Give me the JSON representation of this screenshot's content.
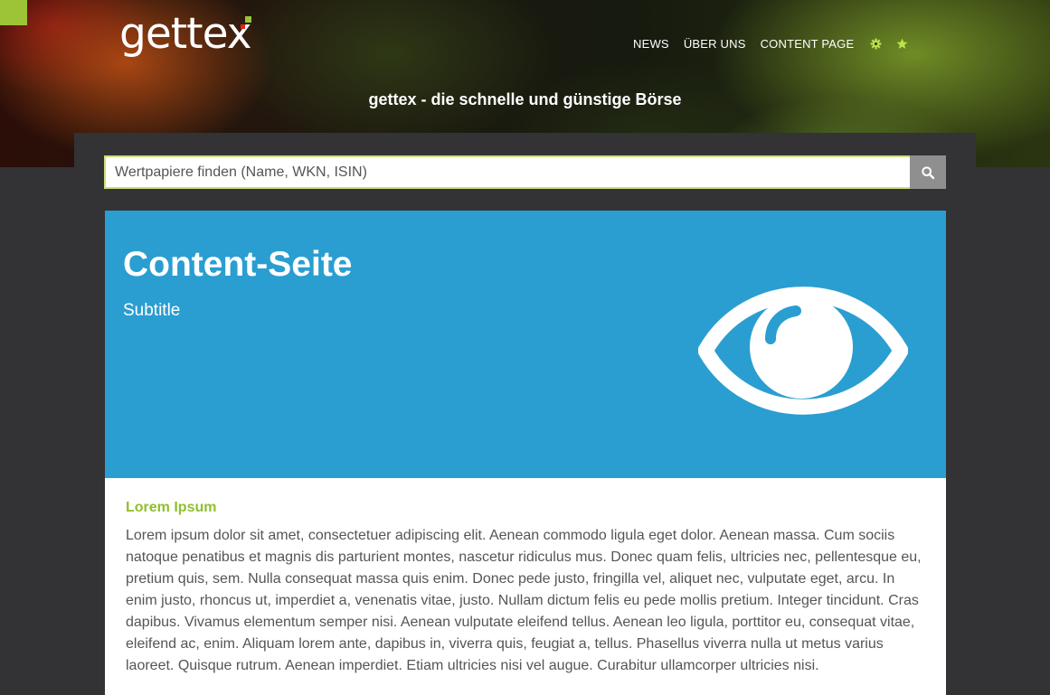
{
  "header": {
    "logo_text": "gettex",
    "nav": [
      {
        "label": "NEWS"
      },
      {
        "label": "ÜBER UNS"
      },
      {
        "label": "CONTENT PAGE"
      }
    ],
    "nav_icons": [
      "gear-icon",
      "star-icon"
    ],
    "tagline": "gettex - die schnelle und günstige Börse"
  },
  "search": {
    "placeholder": "Wertpapiere finden (Name, WKN, ISIN)",
    "value": "",
    "button_icon": "search-icon"
  },
  "banner": {
    "title": "Content-Seite",
    "subtitle": "Subtitle",
    "icon": "eye-icon"
  },
  "content": {
    "heading": "Lorem Ipsum",
    "paragraph": "Lorem ipsum dolor sit amet, consectetuer adipiscing elit. Aenean commodo ligula eget dolor. Aenean massa. Cum sociis natoque penatibus et magnis dis parturient montes, nascetur ridiculus mus. Donec quam felis, ultricies nec, pellentesque eu, pretium quis, sem. Nulla consequat massa quis enim. Donec pede justo, fringilla vel, aliquet nec, vulputate eget, arcu. In enim justo, rhoncus ut, imperdiet a, venenatis vitae, justo. Nullam dictum felis eu pede mollis pretium. Integer tincidunt. Cras dapibus. Vivamus elementum semper nisi. Aenean vulputate eleifend tellus. Aenean leo ligula, porttitor eu, consequat vitae, eleifend ac, enim. Aliquam lorem ante, dapibus in, viverra quis, feugiat a, tellus. Phasellus viverra nulla ut metus varius laoreet. Quisque rutrum. Aenean imperdiet. Etiam ultricies nisi vel augue. Curabitur ullamcorper ultricies nisi."
  },
  "colors": {
    "brand_green": "#9dc437",
    "brand_red": "#e2231a",
    "banner_blue": "#2a9ed1",
    "background_dark": "#333234"
  }
}
